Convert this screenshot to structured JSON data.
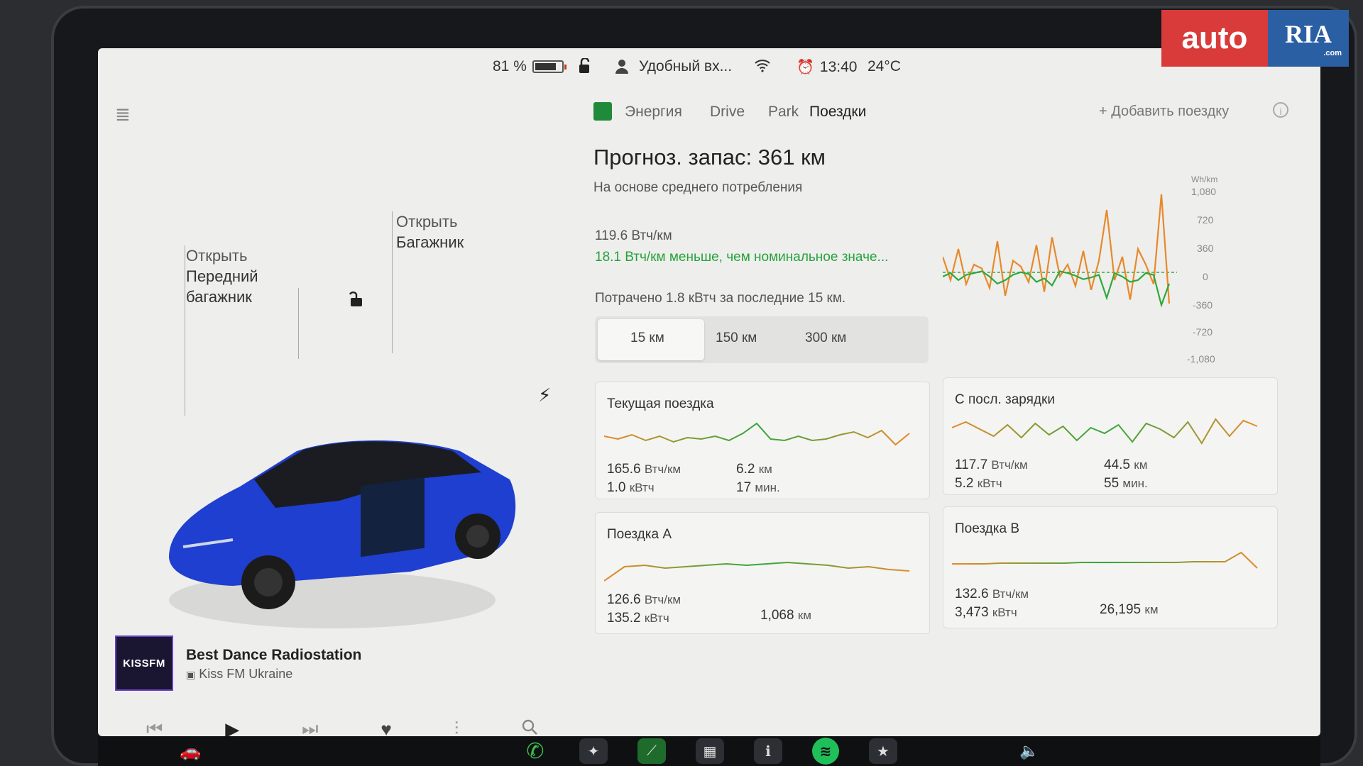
{
  "status": {
    "battery_percent": "81 %",
    "battery_level": 0.81,
    "profile_name": "Удобный вх...",
    "time": "13:40",
    "temperature": "24°C"
  },
  "car_view": {
    "callout_front_line1": "Открыть",
    "callout_front_line2": "Передний",
    "callout_front_line3": "багажник",
    "callout_trunk_line1": "Открыть",
    "callout_trunk_line2": "Багажник",
    "car_color": "#1f3fd0"
  },
  "media": {
    "album_text": "KISSFM",
    "title": "Best Dance Radiostation",
    "subtitle": "Kiss FM Ukraine"
  },
  "energy": {
    "tabs": [
      "Энергия",
      "Drive",
      "Park",
      "Поездки"
    ],
    "active_tab": "Поездки",
    "add_trip_label": "Добавить поездку",
    "range_title": "Прогноз. запас: 361 км",
    "range_subtitle": "На основе среднего потребления",
    "avg_consumption": "119.6 Втч/км",
    "diff_text": "18.1 Втч/км меньше, чем номинальное значе...",
    "spent_text": "Потрачено 1.8 кВтч за последние 15 км.",
    "range_options": [
      "15 км",
      "150 км",
      "300 км"
    ],
    "selected_range": "15 км",
    "axis_unit": "Wh/km",
    "axis_ticks": [
      "1,080",
      "720",
      "360",
      "0",
      "-360",
      "-720",
      "-1,080"
    ],
    "green_color": "#2fa83d",
    "orange_color": "#e8892a"
  },
  "cards": {
    "current": {
      "title": "Текущая поездка",
      "consumption": "165.6",
      "consumption_unit": "Втч/км",
      "energy": "1.0",
      "energy_unit": "кВтч",
      "distance": "6.2",
      "distance_unit": "км",
      "duration": "17",
      "duration_unit": "мин."
    },
    "since_charge": {
      "title": "С посл. зарядки",
      "consumption": "117.7",
      "consumption_unit": "Втч/км",
      "energy": "5.2",
      "energy_unit": "кВтч",
      "distance": "44.5",
      "distance_unit": "км",
      "duration": "55",
      "duration_unit": "мин."
    },
    "trip_a": {
      "title": "Поездка A",
      "consumption": "126.6",
      "consumption_unit": "Втч/км",
      "energy": "135.2",
      "energy_unit": "кВтч",
      "distance": "1,068",
      "distance_unit": "км"
    },
    "trip_b": {
      "title": "Поездка B",
      "consumption": "132.6",
      "consumption_unit": "Втч/км",
      "energy": "3,473",
      "energy_unit": "кВтч",
      "distance": "26,195",
      "distance_unit": "км"
    }
  },
  "watermark": {
    "brand_left": "auto",
    "brand_right": "RIA",
    "suffix": ".com"
  }
}
